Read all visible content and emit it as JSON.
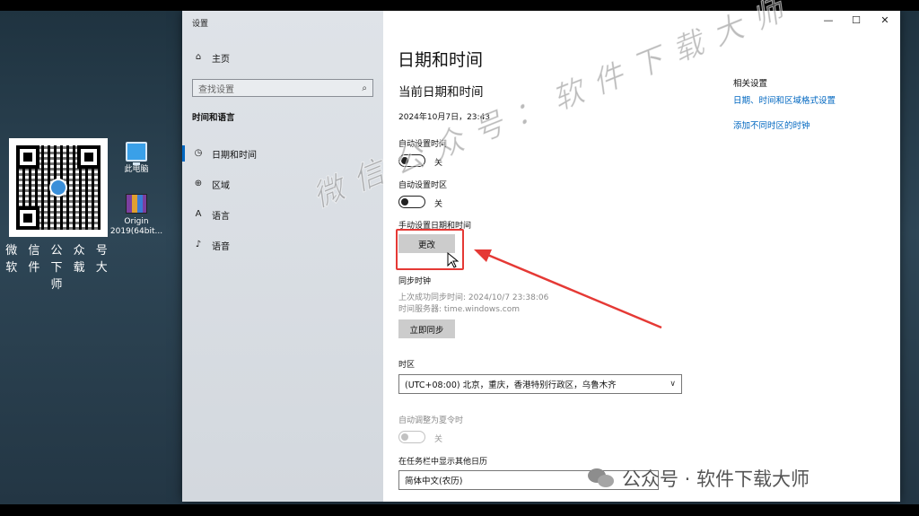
{
  "desktop": {
    "qr_caption_line1": "微 信 公 众 号",
    "qr_caption_line2": "软 件 下 载 大 师",
    "icons": [
      {
        "label": "此电脑",
        "icon": "computer-icon"
      },
      {
        "label": "Origin 2019(64bit...",
        "icon": "winrar-archive-icon"
      }
    ]
  },
  "window": {
    "title": "设置",
    "controls": {
      "minimize": "—",
      "maximize": "☐",
      "close": "✕"
    }
  },
  "sidebar": {
    "home": "主页",
    "search_placeholder": "查找设置",
    "section": "时间和语言",
    "items": [
      {
        "label": "日期和时间",
        "icon": "calendar-clock-icon",
        "active": true
      },
      {
        "label": "区域",
        "icon": "globe-icon",
        "active": false
      },
      {
        "label": "语言",
        "icon": "language-icon",
        "active": false
      },
      {
        "label": "语音",
        "icon": "microphone-icon",
        "active": false
      }
    ]
  },
  "main": {
    "page_title": "日期和时间",
    "current_heading": "当前日期和时间",
    "current_datetime": "2024年10月7日，23:43",
    "auto_time": {
      "label": "自动设置时间",
      "state": "关"
    },
    "auto_zone": {
      "label": "自动设置时区",
      "state": "关"
    },
    "manual": {
      "label": "手动设置日期和时间",
      "button": "更改"
    },
    "sync": {
      "heading": "同步时钟",
      "last_sync": "上次成功同步时间: 2024/10/7 23:38:06",
      "server": "时间服务器: time.windows.com",
      "button": "立即同步"
    },
    "timezone": {
      "label": "时区",
      "value": "(UTC+08:00) 北京，重庆，香港特别行政区，乌鲁木齐"
    },
    "dst": {
      "label": "自动调整为夏令时",
      "state": "关"
    },
    "calendar": {
      "label": "在任务栏中显示其他日历",
      "value": "简体中文(农历)"
    }
  },
  "related": {
    "title": "相关设置",
    "links": [
      "日期、时间和区域格式设置",
      "添加不同时区的时钟"
    ]
  },
  "overlay": {
    "watermark": "微信公众号：软件下载大师",
    "brand_text": "公众号 · 软件下载大师",
    "highlight_color": "#e53935"
  }
}
